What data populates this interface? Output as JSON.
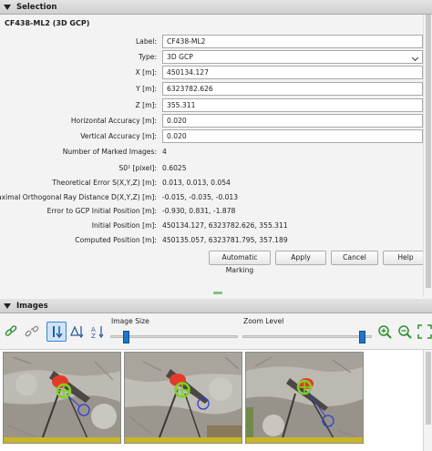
{
  "selection": {
    "header": "Selection",
    "point_title": "CF438-ML2 (3D GCP)",
    "label": {
      "caption": "Label:",
      "value": "CF438-ML2"
    },
    "type": {
      "caption": "Type:",
      "value": "3D GCP"
    },
    "x": {
      "caption": "X [m]:",
      "value": "450134.127"
    },
    "y": {
      "caption": "Y [m]:",
      "value": "6323782.626"
    },
    "z": {
      "caption": "Z [m]:",
      "value": "355.311"
    },
    "horizontal_accuracy": {
      "caption": "Horizontal Accuracy [m]:",
      "value": "0.020"
    },
    "vertical_accuracy": {
      "caption": "Vertical Accuracy [m]:",
      "value": "0.020"
    },
    "marked_images": {
      "caption": "Number of Marked Images:",
      "value": "4"
    },
    "s0": {
      "caption": "S0² [pixel]:",
      "value": "0.6025"
    },
    "theoretical_error": {
      "caption": "Theoretical Error S(X,Y,Z) [m]:",
      "value": "0.013, 0.013, 0.054"
    },
    "max_ray_distance": {
      "caption": "Maximal Orthogonal Ray Distance D(X,Y,Z) [m]:",
      "value": "-0.015, -0.035, -0.013"
    },
    "error_initial": {
      "caption": "Error to GCP Initial Position [m]:",
      "value": "-0.930, 0.831, -1.878"
    },
    "initial_position": {
      "caption": "Initial Position [m]:",
      "value": "450134.127, 6323782.626, 355.311"
    },
    "computed_position": {
      "caption": "Computed Position [m]:",
      "value": "450135.057, 6323781.795, 357.189"
    },
    "buttons": {
      "automatic_marking": "Automatic Marking",
      "apply": "Apply",
      "cancel": "Cancel",
      "help": "Help"
    }
  },
  "images": {
    "header": "Images",
    "image_size_label": "Image Size",
    "zoom_level_label": "Zoom Level",
    "image_size_value": 0.1,
    "zoom_level_value": 0.9,
    "colors": {
      "slider_thumb": "#1f76c9",
      "marker_green": "#7fd321",
      "marker_red": "#e43a2a",
      "marker_blue": "#2f3fd0"
    },
    "toolbar_icons": [
      "link-icon",
      "unlink-icon",
      "sort-vertical-icon",
      "sort-triangle-icon",
      "sort-az-icon",
      "zoom-in-icon",
      "zoom-out-icon",
      "fit-icon"
    ]
  }
}
